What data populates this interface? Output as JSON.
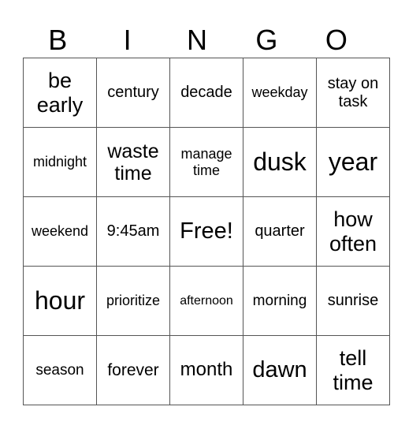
{
  "header": [
    "B",
    "I",
    "N",
    "G",
    "O"
  ],
  "rows": [
    [
      "be early",
      "century",
      "decade",
      "weekday",
      "stay on task"
    ],
    [
      "midnight",
      "waste time",
      "manage time",
      "dusk",
      "year"
    ],
    [
      "weekend",
      "9:45am",
      "Free!",
      "quarter",
      "how often"
    ],
    [
      "hour",
      "prioritize",
      "afternoon",
      "morning",
      "sunrise"
    ],
    [
      "season",
      "forever",
      "month",
      "dawn",
      "tell time"
    ]
  ]
}
